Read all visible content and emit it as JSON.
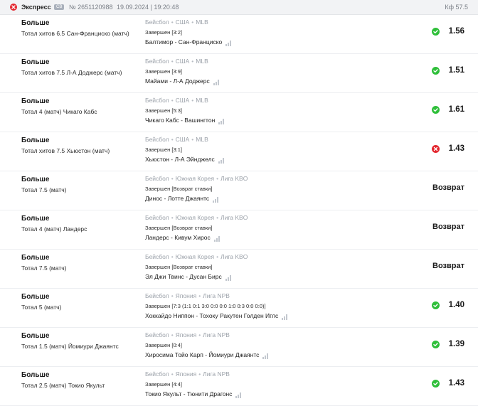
{
  "header": {
    "type_label": "Экспресс",
    "badge": "СВ",
    "number": "№ 2651120988",
    "datetime": "19.09.2024 | 19:20:48",
    "coefficient": "Кф 57.5",
    "status_icon": "close-circle-icon"
  },
  "colors": {
    "win": "#2fbf3a",
    "loss": "#e3262e"
  },
  "bets": [
    {
      "market": "Больше",
      "outcome": "Тотал хитов 6.5 Сан-Франциско (матч)",
      "sport": "Бейсбол",
      "country": "США",
      "league": "MLB",
      "status": "Завершен [3:2]",
      "teams": "Балтимор - Сан-Франциско",
      "result": "win",
      "coef": "1.56"
    },
    {
      "market": "Больше",
      "outcome": "Тотал хитов 7.5 Л-А Доджерс (матч)",
      "sport": "Бейсбол",
      "country": "США",
      "league": "MLB",
      "status": "Завершен [3:9]",
      "teams": "Майами - Л-А Доджерс",
      "result": "win",
      "coef": "1.51"
    },
    {
      "market": "Больше",
      "outcome": "Тотал 4 (матч) Чикаго Кабс",
      "sport": "Бейсбол",
      "country": "США",
      "league": "MLB",
      "status": "Завершен [5:3]",
      "teams": "Чикаго Кабс - Вашингтон",
      "result": "win",
      "coef": "1.61"
    },
    {
      "market": "Больше",
      "outcome": "Тотал хитов 7.5 Хьюстон (матч)",
      "sport": "Бейсбол",
      "country": "США",
      "league": "MLB",
      "status": "Завершен [3:1]",
      "teams": "Хьюстон - Л-А Эйнджелс",
      "result": "loss",
      "coef": "1.43"
    },
    {
      "market": "Больше",
      "outcome": "Тотал 7.5 (матч)",
      "sport": "Бейсбол",
      "country": "Южная Корея",
      "league": "Лига KBO",
      "status": "Завершен [Возврат ставки]",
      "teams": "Динос - Лотте Джаянтс",
      "result": "refund",
      "coef": "Возврат"
    },
    {
      "market": "Больше",
      "outcome": "Тотал 4 (матч) Ландерс",
      "sport": "Бейсбол",
      "country": "Южная Корея",
      "league": "Лига KBO",
      "status": "Завершен [Возврат ставки]",
      "teams": "Ландерс - Кивум Хирос",
      "result": "refund",
      "coef": "Возврат"
    },
    {
      "market": "Больше",
      "outcome": "Тотал 7.5 (матч)",
      "sport": "Бейсбол",
      "country": "Южная Корея",
      "league": "Лига KBO",
      "status": "Завершен [Возврат ставки]",
      "teams": "Эл Джи Твинс - Дусан Бирс",
      "result": "refund",
      "coef": "Возврат"
    },
    {
      "market": "Больше",
      "outcome": "Тотал 5 (матч)",
      "sport": "Бейсбол",
      "country": "Япония",
      "league": "Лига NPB",
      "status": "Завершен [7:3 (1:1 0:1 3:0 0:0 0:0 1:0 0:3 0:0 0:0)]",
      "teams": "Хоккайдо Ниппон - Тохоку Ракутен Голден Иглс",
      "result": "win",
      "coef": "1.40"
    },
    {
      "market": "Больше",
      "outcome": "Тотал 1.5 (матч) Йомиури Джаянтс",
      "sport": "Бейсбол",
      "country": "Япония",
      "league": "Лига NPB",
      "status": "Завершен [0:4]",
      "teams": "Хиросима Тойо Карп - Йомиури Джаянтс",
      "result": "win",
      "coef": "1.39"
    },
    {
      "market": "Больше",
      "outcome": "Тотал 2.5 (матч) Токио Якульт",
      "sport": "Бейсбол",
      "country": "Япония",
      "league": "Лига NPB",
      "status": "Завершен [4:4]",
      "teams": "Токио Якульт - Тюнити Драгонс",
      "result": "win",
      "coef": "1.43"
    }
  ]
}
